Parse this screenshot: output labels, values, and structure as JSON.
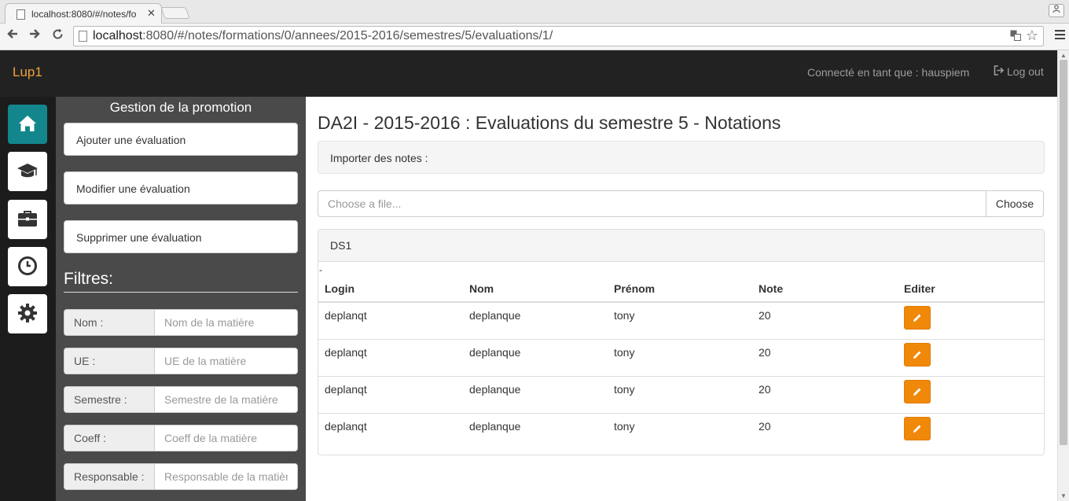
{
  "browser": {
    "tab_title": "localhost:8080/#/notes/fo",
    "tab_close": "✕",
    "url_host": "localhost",
    "url_rest": ":8080/#/notes/formations/0/annees/2015-2016/semestres/5/evaluations/1/"
  },
  "navbar": {
    "brand": "Lup1",
    "connected_text": "Connecté en tant que : hauspiem",
    "logout_label": "Log out"
  },
  "sidebar": {
    "items": [
      {
        "icon": "home-icon",
        "active": true
      },
      {
        "icon": "graduation-cap-icon",
        "active": false
      },
      {
        "icon": "briefcase-icon",
        "active": false
      },
      {
        "icon": "clock-icon",
        "active": false
      },
      {
        "icon": "gear-icon",
        "active": false
      }
    ]
  },
  "panel": {
    "title": "Gestion de la promotion",
    "buttons": [
      "Ajouter une évaluation",
      "Modifier une évaluation",
      "Supprimer une évaluation"
    ],
    "filters_title": "Filtres:",
    "filters": [
      {
        "label": "Nom :",
        "placeholder": "Nom de la matière"
      },
      {
        "label": "UE :",
        "placeholder": "UE de la matière"
      },
      {
        "label": "Semestre :",
        "placeholder": "Semestre de la matière"
      },
      {
        "label": "Coeff :",
        "placeholder": "Coeff de la matière"
      },
      {
        "label": "Responsable :",
        "placeholder": "Responsable de la matière"
      }
    ]
  },
  "main": {
    "title": "DA2I - 2015-2016 : Evaluations du semestre 5 - Notations",
    "import_label": "Importer des notes :",
    "file_placeholder": "Choose a file...",
    "file_button": "Choose",
    "evaluation": {
      "name": "DS1",
      "dash": "-",
      "columns": [
        "Login",
        "Nom",
        "Prénom",
        "Note",
        "Editer"
      ],
      "rows": [
        {
          "login": "deplanqt",
          "nom": "deplanque",
          "prenom": "tony",
          "note": "20"
        },
        {
          "login": "deplanqt",
          "nom": "deplanque",
          "prenom": "tony",
          "note": "20"
        },
        {
          "login": "deplanqt",
          "nom": "deplanque",
          "prenom": "tony",
          "note": "20"
        },
        {
          "login": "deplanqt",
          "nom": "deplanque",
          "prenom": "tony",
          "note": "20"
        }
      ]
    }
  },
  "colors": {
    "brand": "#f0a13c",
    "navbar": "#222222",
    "accent_teal": "#13868d",
    "edit_orange": "#f0880a",
    "panel_bg": "#4a4a4a"
  }
}
